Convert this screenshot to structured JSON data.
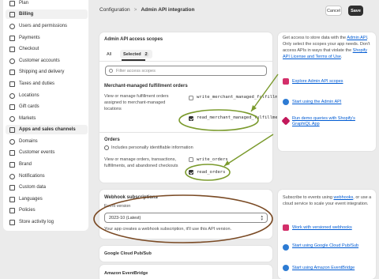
{
  "sidebar": {
    "items": [
      {
        "label": "Plan",
        "icon": "plan-icon"
      },
      {
        "label": "Billing",
        "icon": "billing-icon",
        "active": true
      },
      {
        "label": "Users and permissions",
        "icon": "users-icon"
      },
      {
        "label": "Payments",
        "icon": "payments-icon"
      },
      {
        "label": "Checkout",
        "icon": "checkout-icon"
      },
      {
        "label": "Customer accounts",
        "icon": "customer-accounts-icon"
      },
      {
        "label": "Shipping and delivery",
        "icon": "shipping-icon"
      },
      {
        "label": "Taxes and duties",
        "icon": "taxes-icon"
      },
      {
        "label": "Locations",
        "icon": "location-icon"
      },
      {
        "label": "Gift cards",
        "icon": "gift-card-icon"
      },
      {
        "label": "Markets",
        "icon": "markets-icon"
      },
      {
        "label": "Apps and sales channels",
        "icon": "apps-icon"
      },
      {
        "label": "Domains",
        "icon": "domains-icon"
      },
      {
        "label": "Customer events",
        "icon": "customer-events-icon"
      },
      {
        "label": "Brand",
        "icon": "brand-icon"
      },
      {
        "label": "Notifications",
        "icon": "notifications-icon"
      },
      {
        "label": "Custom data",
        "icon": "custom-data-icon"
      },
      {
        "label": "Languages",
        "icon": "languages-icon"
      },
      {
        "label": "Policies",
        "icon": "policies-icon"
      },
      {
        "label": "Store activity log",
        "icon": "activity-log-icon"
      }
    ]
  },
  "header": {
    "breadcrumb_parent": "Configuration",
    "breadcrumb_sep": ">",
    "title": "Admin API integration",
    "cancel_label": "Cancel",
    "save_label": "Save"
  },
  "scopes": {
    "title": "Admin API access scopes",
    "tab_all": "All",
    "tab_selected": "Selected",
    "selected_count": "2",
    "filter_placeholder": "Filter access scopes",
    "fulfillment": {
      "heading": "Merchant-managed fulfillment orders",
      "description": "View or manage fulfillment orders assigned to merchant-managed locations",
      "write_scope": "write_merchant_managed_fulfillment_orders",
      "read_scope": "read_merchant_managed_fulfillment_orders"
    },
    "orders": {
      "heading": "Orders",
      "pii_note": "Includes personally identifiable information",
      "description": "View or manage orders, transactions, fulfillments, and abandoned checkouts",
      "write_scope": "write_orders",
      "read_scope": "read_orders"
    }
  },
  "webhooks": {
    "title": "Webhook subscriptions",
    "event_version_label": "Event version",
    "event_version_value": "2023-10 (Latest)",
    "help_text": "Your app creates a webhook subscription, it'll use this API version."
  },
  "collapsibles": [
    "Google Cloud Pub/Sub",
    "Amazon EventBridge"
  ],
  "right_top": {
    "text_1": "Get access to store data with the ",
    "link_admin_api": "Admin API",
    "text_2": ". Only select the scopes your app needs. Don't access APIs in ways that violate the ",
    "link_license": "Shopify API License and Terms of Use",
    "text_3": ".",
    "links": [
      {
        "label": "Explore Admin API scopes",
        "icon": "book-icon"
      },
      {
        "label": "Start using the Admin API",
        "icon": "play-icon"
      },
      {
        "label": "Run demo queries with Shopify's GraphiQL App",
        "icon": "graphql-icon"
      }
    ]
  },
  "right_bottom": {
    "text_1": "Subscribe to events using ",
    "link_webhooks": "webhooks",
    "text_2": ", or use a cloud service to scale your event integration.",
    "links": [
      {
        "label": "Work with versioned webhooks",
        "icon": "book-icon"
      },
      {
        "label": "Start using Google Cloud Pub/Sub",
        "icon": "play-icon"
      },
      {
        "label": "Start using Amazon EventBridge",
        "icon": "play-icon"
      }
    ]
  },
  "colors": {
    "annotation": "#7a9a2c",
    "annotation_brown": "#7a4a24",
    "link": "#005bd3",
    "primary_button": "#303030"
  }
}
